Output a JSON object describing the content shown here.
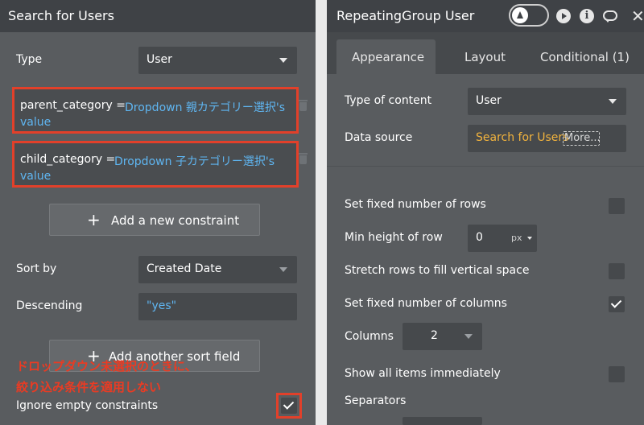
{
  "left": {
    "title": "Search for Users",
    "type_label": "Type",
    "type_value": "User",
    "constraints": [
      {
        "key": "parent_category =",
        "value_line1": "Dropdown 親カテゴリー選択's",
        "value_line2": "value"
      },
      {
        "key": "child_category =",
        "value_line1": "Dropdown 子カテゴリー選択's",
        "value_line2": "value"
      }
    ],
    "add_constraint": "Add a new constraint",
    "sort_by_label": "Sort by",
    "sort_by_value": "Created Date",
    "descending_label": "Descending",
    "descending_value": "\"yes\"",
    "add_sort": "Add another sort field",
    "annotation_line1": "ドロップダウン未選択のときに、",
    "annotation_line2": "絞り込み条件を適用しない",
    "ignore_label": "Ignore empty constraints",
    "ignore_checked": true,
    "highlight_color": "#e2402a"
  },
  "right": {
    "title": "RepeatingGroup User",
    "tabs": [
      "Appearance",
      "Layout",
      "Conditional (1)"
    ],
    "active_tab": "Appearance",
    "type_of_content_label": "Type of content",
    "type_of_content_value": "User",
    "data_source_label": "Data source",
    "data_source_value": "Search for Users",
    "data_source_more": "More...",
    "fixed_rows_label": "Set fixed number of rows",
    "fixed_rows_checked": false,
    "min_height_label": "Min height of row",
    "min_height_value": "0",
    "min_height_unit": "px",
    "stretch_label": "Stretch rows to fill vertical space",
    "stretch_checked": false,
    "fixed_columns_label": "Set fixed number of columns",
    "fixed_columns_checked": true,
    "columns_label": "Columns",
    "columns_value": "2",
    "show_all_label": "Show all items immediately",
    "show_all_checked": false,
    "separators_label": "Separators"
  },
  "icons": [
    "flask-icon",
    "play-icon",
    "info-icon",
    "comment-icon",
    "close-icon",
    "trash-icon",
    "plus-icon",
    "chevron-down-icon",
    "checkmark-icon"
  ],
  "colors": {
    "panel": "#595c5f",
    "header": "#3f4246",
    "link_blue": "#5fb6f2",
    "data_source_orange": "#f2b33d",
    "annotation_red": "#ea3b23"
  }
}
